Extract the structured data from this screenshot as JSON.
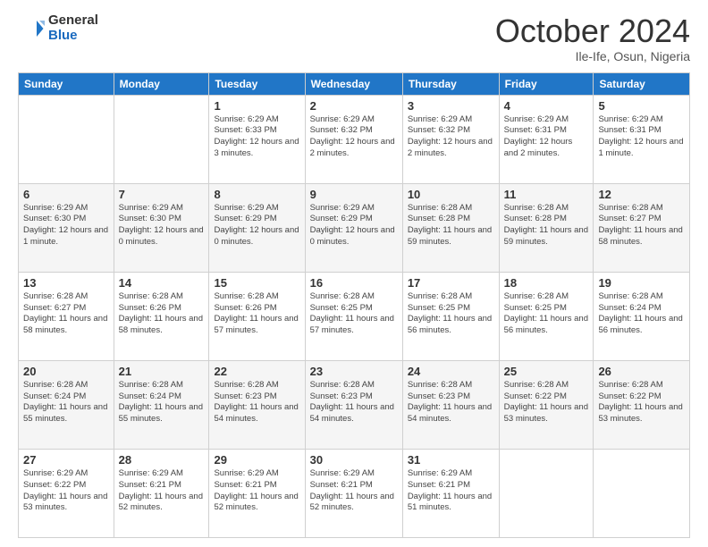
{
  "logo": {
    "general": "General",
    "blue": "Blue"
  },
  "header": {
    "month": "October 2024",
    "location": "Ile-Ife, Osun, Nigeria"
  },
  "weekdays": [
    "Sunday",
    "Monday",
    "Tuesday",
    "Wednesday",
    "Thursday",
    "Friday",
    "Saturday"
  ],
  "weeks": [
    [
      {
        "day": "",
        "info": ""
      },
      {
        "day": "",
        "info": ""
      },
      {
        "day": "1",
        "info": "Sunrise: 6:29 AM\nSunset: 6:33 PM\nDaylight: 12 hours and 3 minutes."
      },
      {
        "day": "2",
        "info": "Sunrise: 6:29 AM\nSunset: 6:32 PM\nDaylight: 12 hours and 2 minutes."
      },
      {
        "day": "3",
        "info": "Sunrise: 6:29 AM\nSunset: 6:32 PM\nDaylight: 12 hours and 2 minutes."
      },
      {
        "day": "4",
        "info": "Sunrise: 6:29 AM\nSunset: 6:31 PM\nDaylight: 12 hours and 2 minutes."
      },
      {
        "day": "5",
        "info": "Sunrise: 6:29 AM\nSunset: 6:31 PM\nDaylight: 12 hours and 1 minute."
      }
    ],
    [
      {
        "day": "6",
        "info": "Sunrise: 6:29 AM\nSunset: 6:30 PM\nDaylight: 12 hours and 1 minute."
      },
      {
        "day": "7",
        "info": "Sunrise: 6:29 AM\nSunset: 6:30 PM\nDaylight: 12 hours and 0 minutes."
      },
      {
        "day": "8",
        "info": "Sunrise: 6:29 AM\nSunset: 6:29 PM\nDaylight: 12 hours and 0 minutes."
      },
      {
        "day": "9",
        "info": "Sunrise: 6:29 AM\nSunset: 6:29 PM\nDaylight: 12 hours and 0 minutes."
      },
      {
        "day": "10",
        "info": "Sunrise: 6:28 AM\nSunset: 6:28 PM\nDaylight: 11 hours and 59 minutes."
      },
      {
        "day": "11",
        "info": "Sunrise: 6:28 AM\nSunset: 6:28 PM\nDaylight: 11 hours and 59 minutes."
      },
      {
        "day": "12",
        "info": "Sunrise: 6:28 AM\nSunset: 6:27 PM\nDaylight: 11 hours and 58 minutes."
      }
    ],
    [
      {
        "day": "13",
        "info": "Sunrise: 6:28 AM\nSunset: 6:27 PM\nDaylight: 11 hours and 58 minutes."
      },
      {
        "day": "14",
        "info": "Sunrise: 6:28 AM\nSunset: 6:26 PM\nDaylight: 11 hours and 58 minutes."
      },
      {
        "day": "15",
        "info": "Sunrise: 6:28 AM\nSunset: 6:26 PM\nDaylight: 11 hours and 57 minutes."
      },
      {
        "day": "16",
        "info": "Sunrise: 6:28 AM\nSunset: 6:25 PM\nDaylight: 11 hours and 57 minutes."
      },
      {
        "day": "17",
        "info": "Sunrise: 6:28 AM\nSunset: 6:25 PM\nDaylight: 11 hours and 56 minutes."
      },
      {
        "day": "18",
        "info": "Sunrise: 6:28 AM\nSunset: 6:25 PM\nDaylight: 11 hours and 56 minutes."
      },
      {
        "day": "19",
        "info": "Sunrise: 6:28 AM\nSunset: 6:24 PM\nDaylight: 11 hours and 56 minutes."
      }
    ],
    [
      {
        "day": "20",
        "info": "Sunrise: 6:28 AM\nSunset: 6:24 PM\nDaylight: 11 hours and 55 minutes."
      },
      {
        "day": "21",
        "info": "Sunrise: 6:28 AM\nSunset: 6:24 PM\nDaylight: 11 hours and 55 minutes."
      },
      {
        "day": "22",
        "info": "Sunrise: 6:28 AM\nSunset: 6:23 PM\nDaylight: 11 hours and 54 minutes."
      },
      {
        "day": "23",
        "info": "Sunrise: 6:28 AM\nSunset: 6:23 PM\nDaylight: 11 hours and 54 minutes."
      },
      {
        "day": "24",
        "info": "Sunrise: 6:28 AM\nSunset: 6:23 PM\nDaylight: 11 hours and 54 minutes."
      },
      {
        "day": "25",
        "info": "Sunrise: 6:28 AM\nSunset: 6:22 PM\nDaylight: 11 hours and 53 minutes."
      },
      {
        "day": "26",
        "info": "Sunrise: 6:28 AM\nSunset: 6:22 PM\nDaylight: 11 hours and 53 minutes."
      }
    ],
    [
      {
        "day": "27",
        "info": "Sunrise: 6:29 AM\nSunset: 6:22 PM\nDaylight: 11 hours and 53 minutes."
      },
      {
        "day": "28",
        "info": "Sunrise: 6:29 AM\nSunset: 6:21 PM\nDaylight: 11 hours and 52 minutes."
      },
      {
        "day": "29",
        "info": "Sunrise: 6:29 AM\nSunset: 6:21 PM\nDaylight: 11 hours and 52 minutes."
      },
      {
        "day": "30",
        "info": "Sunrise: 6:29 AM\nSunset: 6:21 PM\nDaylight: 11 hours and 52 minutes."
      },
      {
        "day": "31",
        "info": "Sunrise: 6:29 AM\nSunset: 6:21 PM\nDaylight: 11 hours and 51 minutes."
      },
      {
        "day": "",
        "info": ""
      },
      {
        "day": "",
        "info": ""
      }
    ]
  ]
}
